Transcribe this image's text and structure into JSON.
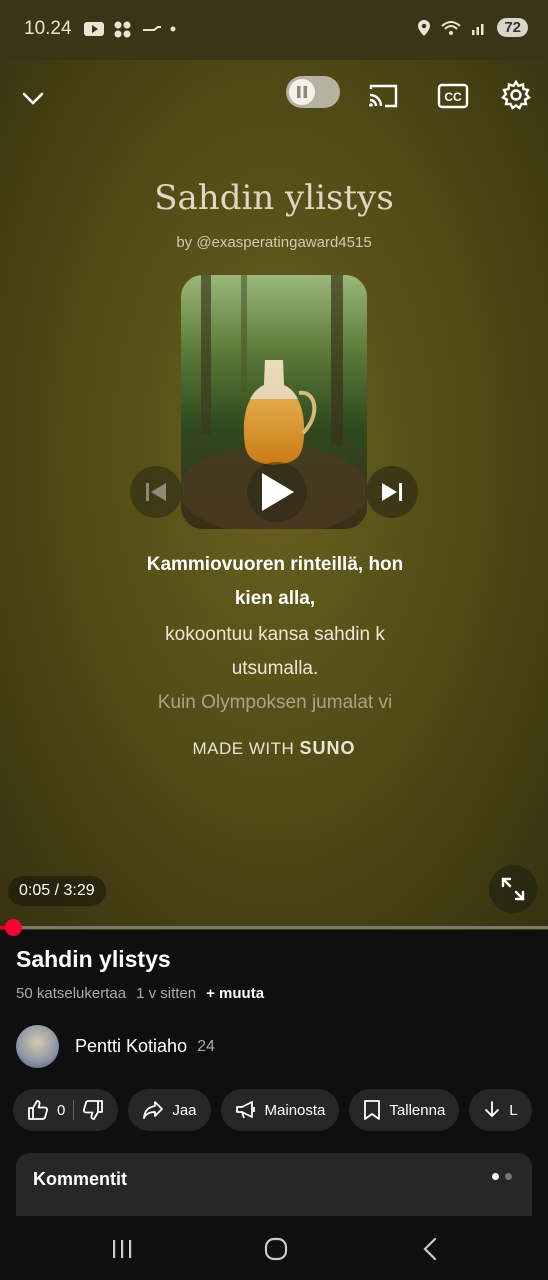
{
  "status_bar": {
    "time": "10.24",
    "battery": "72"
  },
  "player": {
    "song_title": "Sahdin ylistys",
    "song_by": "by @exasperatingaward4515",
    "lyrics": {
      "current": "Kammiovuoren rinteillä, hon kien alla,",
      "next": "kokoontuu kansa sahdin k utsumalla.",
      "upcoming": "Kuin Olympoksen jumalat vi"
    },
    "made_with_prefix": "MADE WITH",
    "made_with_brand": "SUNO",
    "time_display": "0:05 / 3:29",
    "progress_fraction": 0.024
  },
  "video": {
    "title": "Sahdin ylistys",
    "views": "50 katselukertaa",
    "age": "1 v sitten",
    "more": "+ muuta"
  },
  "channel": {
    "name": "Pentti Kotiaho",
    "subscribers": "24"
  },
  "actions": {
    "like_count": "0",
    "share": "Jaa",
    "promote": "Mainosta",
    "save": "Tallenna",
    "download": "L"
  },
  "comments": {
    "title": "Kommentit"
  }
}
